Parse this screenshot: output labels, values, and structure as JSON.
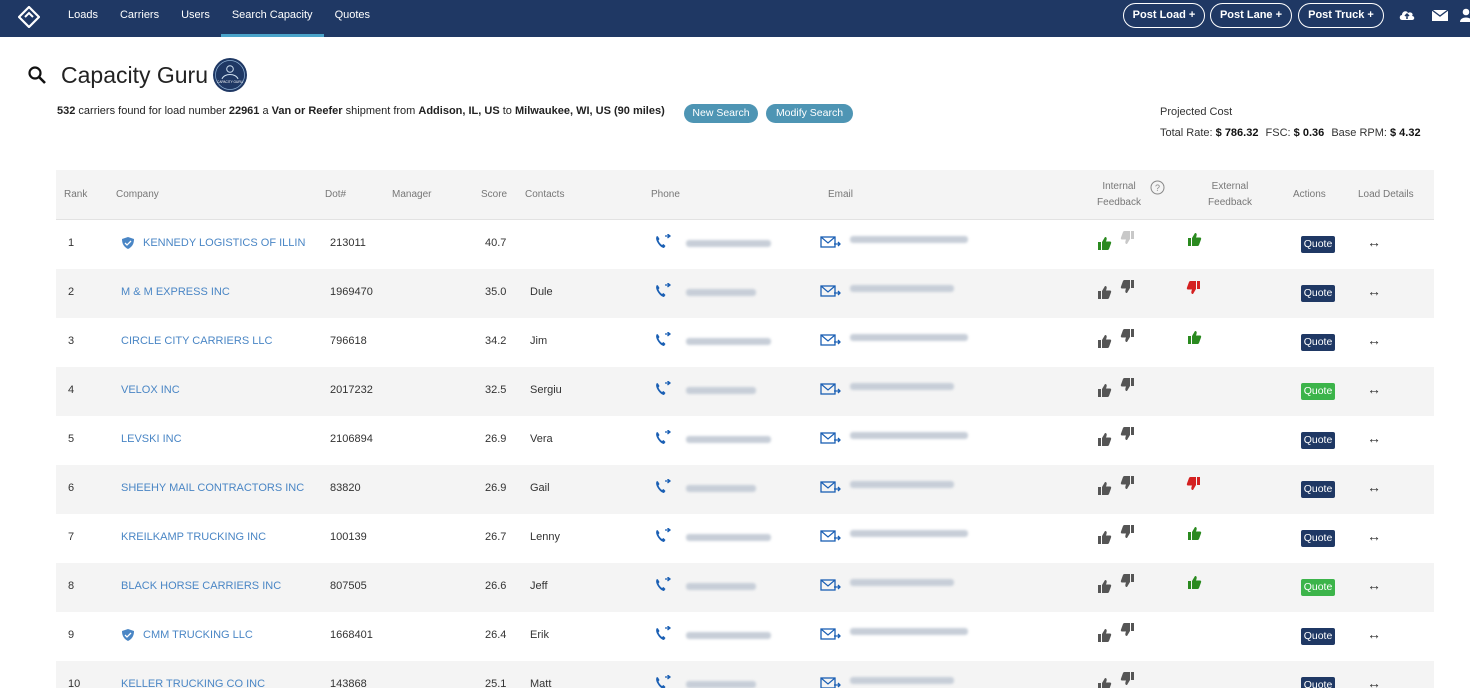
{
  "nav": {
    "items": [
      "Loads",
      "Carriers",
      "Users",
      "Search Capacity",
      "Quotes"
    ],
    "active": "Search Capacity",
    "post_load": "Post Load +",
    "post_lane": "Post Lane +",
    "post_truck": "Post Truck +"
  },
  "page": {
    "title": "Capacity Guru",
    "badge_text": "CAPACITY GURU"
  },
  "summary": {
    "count": "532",
    "t1": " carriers found for load number ",
    "load_number": "22961",
    "t2": " a ",
    "equipment": "Van or Reefer",
    "t3": " shipment from ",
    "origin": "Addison, IL, US",
    "t4": " to ",
    "destination": "Milwaukee, WI, US (90 miles)",
    "new_search": "New Search",
    "modify_search": "Modify Search"
  },
  "projected": {
    "label": "Projected Cost",
    "total_rate_label": "Total Rate: ",
    "total_rate": "$ 786.32",
    "fsc_label": "FSC: ",
    "fsc": "$ 0.36",
    "rpm_label": "Base RPM: ",
    "rpm": "$ 4.32"
  },
  "table": {
    "headers": {
      "rank": "Rank",
      "company": "Company",
      "dot": "Dot#",
      "manager": "Manager",
      "score": "Score",
      "contacts": "Contacts",
      "phone": "Phone",
      "email": "Email",
      "internal_1": "Internal",
      "internal_2": "Feedback",
      "external_1": "External",
      "external_2": "Feedback",
      "actions": "Actions",
      "load_details": "Load Details"
    },
    "quote_label": "Quote",
    "arrow": "↔",
    "rows": [
      {
        "rank": "1",
        "company": "KENNEDY LOGISTICS OF ILLINOIS",
        "shield": true,
        "dot": "213011",
        "score": "40.7",
        "contact": "",
        "internal_up": "green",
        "internal_down": "light",
        "external": "up",
        "quote": "navy"
      },
      {
        "rank": "2",
        "company": "M & M EXPRESS INC",
        "shield": false,
        "dot": "1969470",
        "score": "35.0",
        "contact": "Dule",
        "internal_up": "gray",
        "internal_down": "gray",
        "external": "down",
        "quote": "navy"
      },
      {
        "rank": "3",
        "company": "CIRCLE CITY CARRIERS LLC",
        "shield": false,
        "dot": "796618",
        "score": "34.2",
        "contact": "Jim",
        "internal_up": "gray",
        "internal_down": "gray",
        "external": "up",
        "quote": "navy"
      },
      {
        "rank": "4",
        "company": "VELOX INC",
        "shield": false,
        "dot": "2017232",
        "score": "32.5",
        "contact": "Sergiu",
        "internal_up": "gray",
        "internal_down": "gray",
        "external": "",
        "quote": "green"
      },
      {
        "rank": "5",
        "company": "LEVSKI INC",
        "shield": false,
        "dot": "2106894",
        "score": "26.9",
        "contact": "Vera",
        "internal_up": "gray",
        "internal_down": "gray",
        "external": "",
        "quote": "navy"
      },
      {
        "rank": "6",
        "company": "SHEEHY MAIL CONTRACTORS INC",
        "shield": false,
        "dot": "83820",
        "score": "26.9",
        "contact": "Gail",
        "internal_up": "gray",
        "internal_down": "gray",
        "external": "down",
        "quote": "navy"
      },
      {
        "rank": "7",
        "company": "KREILKAMP TRUCKING INC",
        "shield": false,
        "dot": "100139",
        "score": "26.7",
        "contact": "Lenny",
        "internal_up": "gray",
        "internal_down": "gray",
        "external": "up",
        "quote": "navy"
      },
      {
        "rank": "8",
        "company": "BLACK HORSE CARRIERS INC",
        "shield": false,
        "dot": "807505",
        "score": "26.6",
        "contact": "Jeff",
        "internal_up": "gray",
        "internal_down": "gray",
        "external": "up",
        "quote": "green"
      },
      {
        "rank": "9",
        "company": "CMM TRUCKING LLC",
        "shield": true,
        "dot": "1668401",
        "score": "26.4",
        "contact": "Erik",
        "internal_up": "gray",
        "internal_down": "gray",
        "external": "",
        "quote": "navy"
      },
      {
        "rank": "10",
        "company": "KELLER TRUCKING CO INC",
        "shield": false,
        "dot": "143868",
        "score": "25.1",
        "contact": "Matt",
        "internal_up": "gray",
        "internal_down": "gray",
        "external": "",
        "quote": "navy"
      }
    ]
  },
  "colors": {
    "navbar": "#1f3864",
    "link": "#4a86c5",
    "pill": "#4e95b4",
    "thumb_green": "#2a8a1f",
    "thumb_red": "#d42020",
    "thumb_gray": "#555555"
  },
  "icons": [
    "logo-icon",
    "cloud-upload-icon",
    "mail-icon",
    "user-icon",
    "search-icon",
    "shield-icon",
    "phone-icon",
    "email-icon",
    "thumbs-up-icon",
    "thumbs-down-icon",
    "swap-arrow-icon"
  ]
}
